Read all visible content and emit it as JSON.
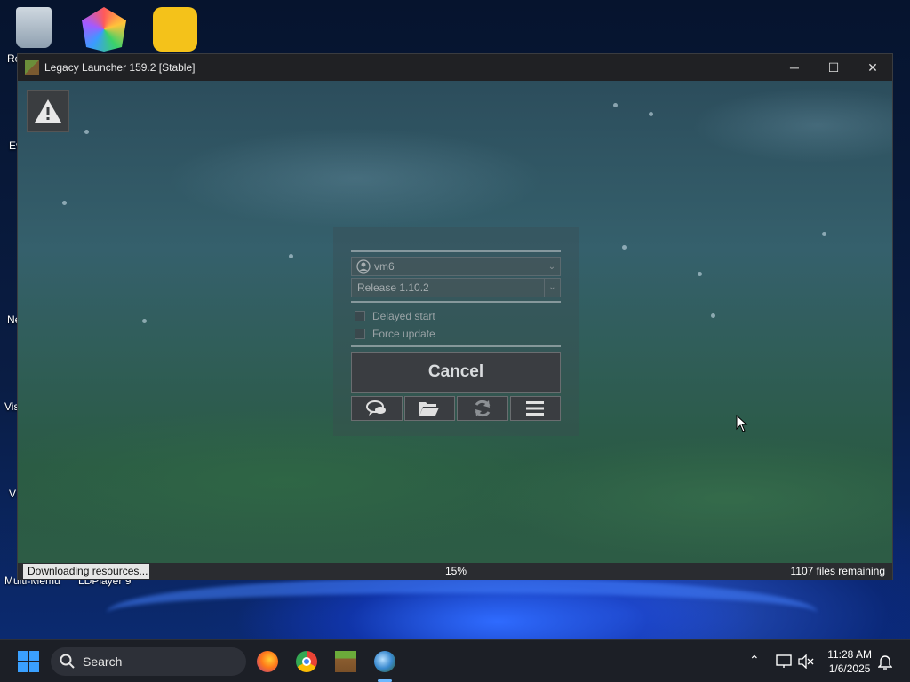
{
  "window": {
    "title": "Legacy Launcher 159.2 [Stable]",
    "minimize_icon": "─",
    "maximize_icon": "☐",
    "close_icon": "✕"
  },
  "launcher": {
    "account": "vm6",
    "version": "Release 1.10.2",
    "delayed_start_label": "Delayed start",
    "force_update_label": "Force update",
    "delayed_start_checked": false,
    "force_update_checked": false,
    "cancel_label": "Cancel",
    "tools": [
      "chat-icon",
      "folder-icon",
      "refresh-icon",
      "menu-icon"
    ]
  },
  "status": {
    "left": "Downloading resources...",
    "progress": "15%",
    "right": "1107 files remaining"
  },
  "desktop": {
    "labels": [
      "Re",
      "Ev",
      "Ne",
      "Vis",
      "VL",
      "Multi-Memu",
      "LDPlayer 9"
    ]
  },
  "taskbar": {
    "search_placeholder": "Search",
    "time": "11:28 AM",
    "date": "1/6/2025"
  },
  "colors": {
    "accent": "#2f6bff",
    "window_bg": "#202124",
    "status_bg": "#e6e6e6"
  }
}
